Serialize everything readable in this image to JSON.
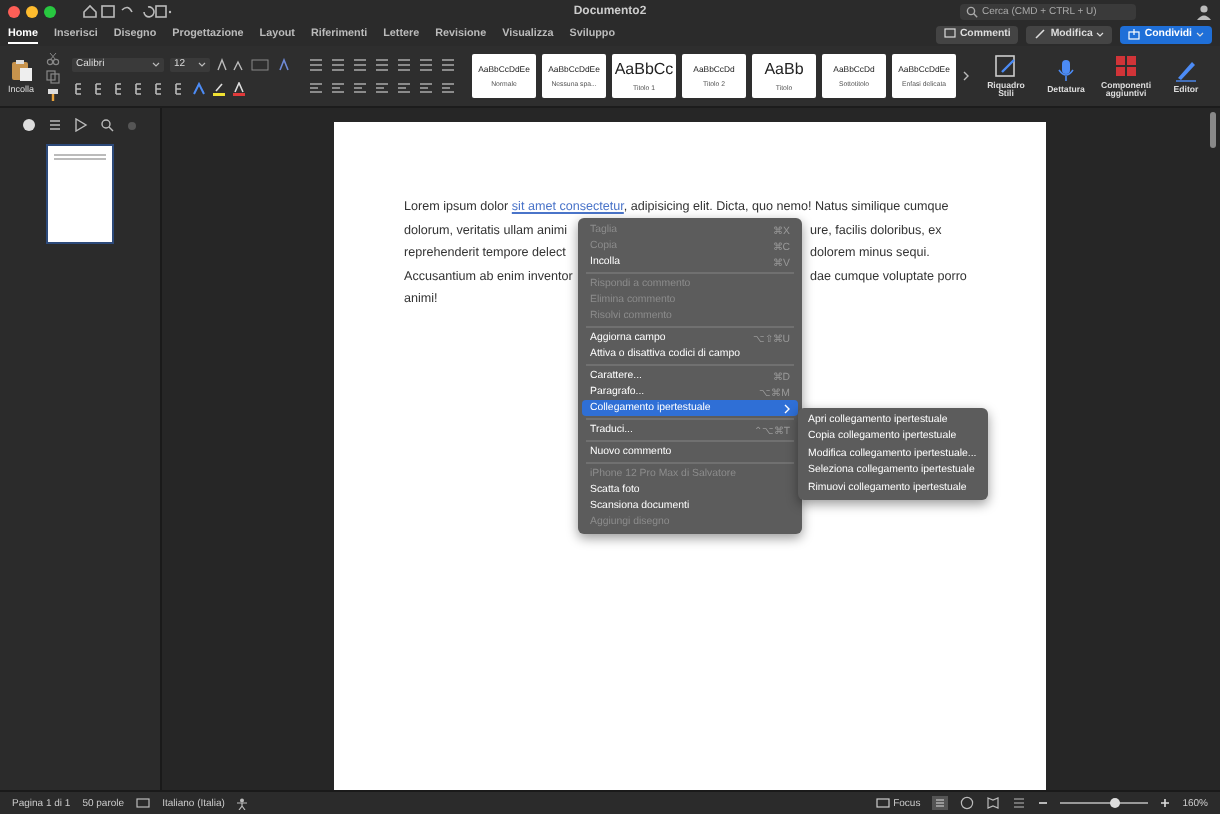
{
  "window": {
    "title": "Documento2"
  },
  "search": {
    "placeholder": "Cerca (CMD + CTRL + U)"
  },
  "tabs": [
    {
      "label": "Home",
      "selected": true
    },
    {
      "label": "Inserisci",
      "selected": false
    },
    {
      "label": "Disegno",
      "selected": false
    },
    {
      "label": "Progettazione",
      "selected": false
    },
    {
      "label": "Layout",
      "selected": false
    },
    {
      "label": "Riferimenti",
      "selected": false
    },
    {
      "label": "Lettere",
      "selected": false
    },
    {
      "label": "Revisione",
      "selected": false
    },
    {
      "label": "Visualizza",
      "selected": false
    },
    {
      "label": "Sviluppo",
      "selected": false
    }
  ],
  "header_buttons": [
    {
      "label": "Commenti",
      "kind": "comments"
    },
    {
      "label": "Modifica",
      "kind": "edit"
    },
    {
      "label": "Condividi",
      "kind": "share"
    }
  ],
  "ribbon": {
    "paste": "Incolla",
    "font": "Calibri",
    "size": "12",
    "styles": [
      {
        "sample": "AaBbCcDdEe",
        "name": "Normale",
        "big": false
      },
      {
        "sample": "AaBbCcDdEe",
        "name": "Nessuna spa...",
        "big": false
      },
      {
        "sample": "AaBbCc",
        "name": "Titolo 1",
        "big": true
      },
      {
        "sample": "AaBbCcDd",
        "name": "Titolo 2",
        "big": false
      },
      {
        "sample": "AaBb",
        "name": "Titolo",
        "big": true
      },
      {
        "sample": "AaBbCcDd",
        "name": "Sottotitolo",
        "big": false
      },
      {
        "sample": "AaBbCcDdEe",
        "name": "Enfasi delicata",
        "big": false
      }
    ],
    "tools": [
      {
        "label": "Riquadro Stili",
        "kind": "styles"
      },
      {
        "label": "Dettatura",
        "kind": "mic"
      },
      {
        "label": "Componenti aggiuntivi",
        "kind": "addins"
      },
      {
        "label": "Editor",
        "kind": "editor"
      }
    ]
  },
  "document": {
    "lines": [
      {
        "left": "Lorem ipsum dolor ",
        "link": "sit amet consectetur",
        "rest": ", adipisicing elit. Dicta, quo nemo! Natus similique cumque"
      },
      {
        "left": "dolorum, veritatis ullam animi",
        "right": "ure, facilis doloribus, ex"
      },
      {
        "left": "reprehenderit tempore delect",
        "right": "dolorem minus sequi."
      },
      {
        "left": "Accusantium ab enim inventor",
        "right": "dae cumque voluptate porro"
      },
      {
        "left": "animi!"
      }
    ]
  },
  "context_menu": {
    "items": [
      {
        "kind": "item",
        "label": "Taglia",
        "shortcut": "⌘X",
        "disabled": true,
        "selected": false
      },
      {
        "kind": "item",
        "label": "Copia",
        "shortcut": "⌘C",
        "disabled": true,
        "selected": false
      },
      {
        "kind": "item",
        "label": "Incolla",
        "shortcut": "⌘V",
        "disabled": false,
        "selected": false
      },
      {
        "kind": "separator"
      },
      {
        "kind": "item",
        "label": "Rispondi a commento",
        "disabled": true,
        "selected": false
      },
      {
        "kind": "item",
        "label": "Elimina commento",
        "disabled": true,
        "selected": false
      },
      {
        "kind": "item",
        "label": "Risolvi commento",
        "disabled": true,
        "selected": false
      },
      {
        "kind": "separator"
      },
      {
        "kind": "item",
        "label": "Aggiorna campo",
        "shortcut": "⌥⇧⌘U",
        "disabled": false,
        "selected": false
      },
      {
        "kind": "item",
        "label": "Attiva o disattiva codici di campo",
        "disabled": false,
        "selected": false
      },
      {
        "kind": "separator"
      },
      {
        "kind": "item",
        "label": "Carattere...",
        "shortcut": "⌘D",
        "disabled": false,
        "selected": false
      },
      {
        "kind": "item",
        "label": "Paragrafo...",
        "shortcut": "⌥⌘M",
        "disabled": false,
        "selected": false
      },
      {
        "kind": "submenu",
        "label": "Collegamento ipertestuale",
        "disabled": false,
        "selected": true
      },
      {
        "kind": "separator"
      },
      {
        "kind": "item",
        "label": "Traduci...",
        "shortcut": "⌃⌥⌘T",
        "disabled": false,
        "selected": false
      },
      {
        "kind": "separator"
      },
      {
        "kind": "item",
        "label": "Nuovo commento",
        "disabled": false,
        "selected": false
      },
      {
        "kind": "separator"
      },
      {
        "kind": "item",
        "label": "iPhone 12 Pro Max di Salvatore",
        "disabled": true,
        "selected": false
      },
      {
        "kind": "item",
        "label": "Scatta foto",
        "disabled": false,
        "selected": false
      },
      {
        "kind": "item",
        "label": "Scansiona documenti",
        "disabled": false,
        "selected": false
      },
      {
        "kind": "item",
        "label": "Aggiungi disegno",
        "disabled": true,
        "selected": false
      }
    ]
  },
  "submenu": {
    "items": [
      "Apri collegamento ipertestuale",
      "Copia collegamento ipertestuale",
      "Modifica collegamento ipertestuale...",
      "Seleziona collegamento ipertestuale",
      "Rimuovi collegamento ipertestuale"
    ]
  },
  "status_bar": {
    "page": "Pagina 1 di 1",
    "words": "50 parole",
    "language": "Italiano (Italia)",
    "focus": "Focus",
    "zoom": {
      "level": 0.62,
      "reading": "160%"
    }
  }
}
